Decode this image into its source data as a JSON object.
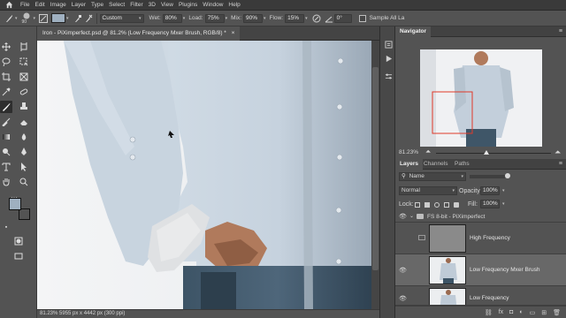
{
  "app": {
    "icon": "home-icon"
  },
  "menu": [
    "File",
    "Edit",
    "Image",
    "Layer",
    "Type",
    "Select",
    "Filter",
    "3D",
    "View",
    "Plugins",
    "Window",
    "Help"
  ],
  "options": {
    "brush_size": "90",
    "mode": "Custom",
    "wet_label": "Wet:",
    "wet_value": "80%",
    "load_label": "Load:",
    "load_value": "75%",
    "mix_label": "Mix:",
    "mix_value": "90%",
    "flow_label": "Flow:",
    "flow_value": "15%",
    "angle_value": "0°",
    "sample_label": "Sample All La"
  },
  "document": {
    "tab_title": "Iron - PiXimperfect.psd @ 81.2% (Low Frequency Mxer Brush, RGB/8) *",
    "close": "×",
    "status": "81.23%   5955 px x 4442 px (300 ppi)"
  },
  "navigator": {
    "title": "Navigator",
    "zoom": "81.23%"
  },
  "layers_panel": {
    "tabs": [
      "Layers",
      "Channels",
      "Paths"
    ],
    "filter_kind": "Name",
    "blend_mode": "Normal",
    "opacity_label": "Opacity:",
    "opacity_value": "100%",
    "lock_label": "Lock:",
    "fill_label": "Fill:",
    "fill_value": "100%",
    "group_name": "FS 8-bit - PiXimperfect",
    "layers": [
      {
        "name": "High Frequency",
        "visible": false,
        "selected": false
      },
      {
        "name": "Low Frequency Mxer Brush",
        "visible": true,
        "selected": true
      },
      {
        "name": "Low Frequency",
        "visible": true,
        "selected": false
      }
    ]
  },
  "colors": {
    "foreground": "#9fb0c0",
    "background": "#ffffff",
    "accent": "#31a8ff"
  }
}
